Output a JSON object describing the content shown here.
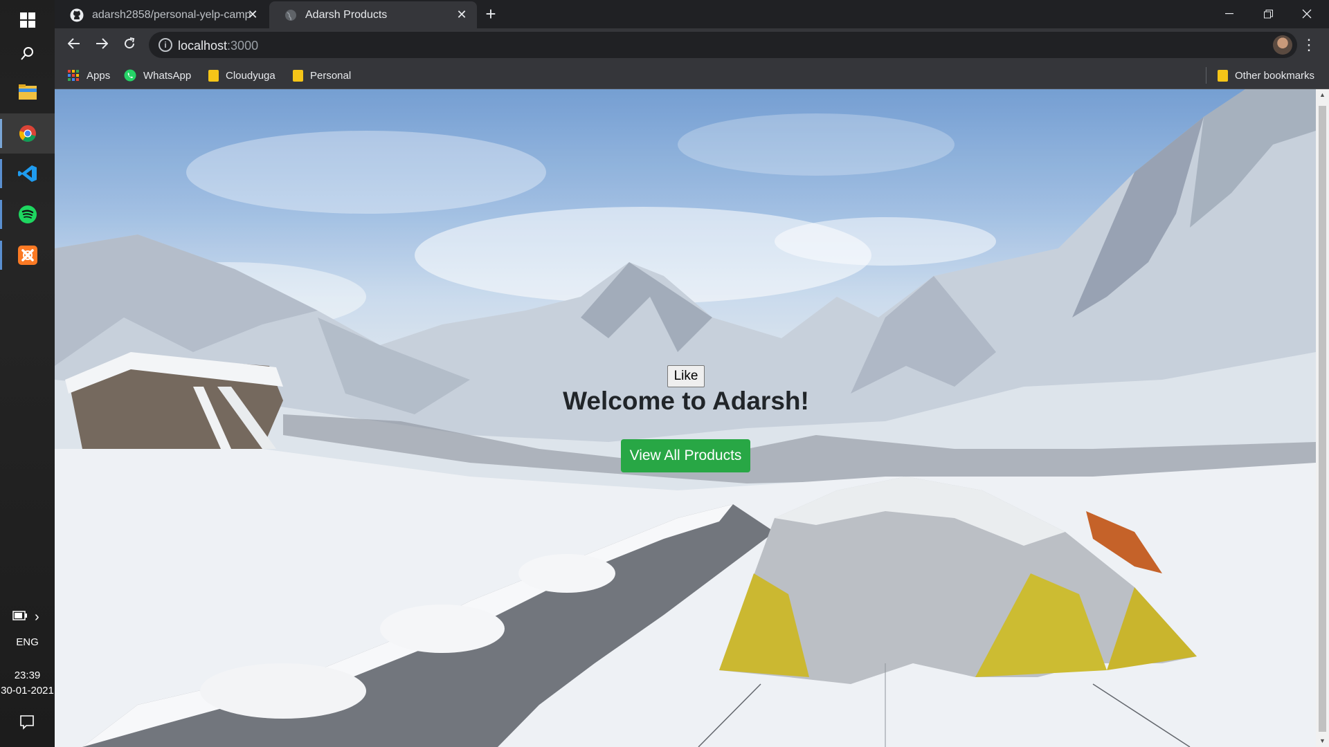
{
  "taskbar": {
    "apps": [
      "windows-start",
      "search",
      "file-explorer",
      "chrome",
      "vscode",
      "spotify",
      "xampp"
    ],
    "language": "ENG",
    "time": "23:39",
    "date": "30-01-2021"
  },
  "browser": {
    "tabs": [
      {
        "title": "adarsh2858/personal-yelp-camp",
        "active": false
      },
      {
        "title": "Adarsh Products",
        "active": true
      }
    ],
    "address": {
      "host": "localhost",
      "port": ":3000"
    },
    "bookmarks": [
      {
        "label": "Apps"
      },
      {
        "label": "WhatsApp"
      },
      {
        "label": "Cloudyuga"
      },
      {
        "label": "Personal"
      }
    ],
    "other_bookmarks": "Other bookmarks"
  },
  "page": {
    "like_label": "Like",
    "heading": "Welcome to Adarsh!",
    "cta_label": "View All Products"
  },
  "colors": {
    "cta": "#28a745",
    "folder": "#f5c518",
    "chrome_dark": "#202124",
    "chrome_toolbar": "#35363a"
  }
}
